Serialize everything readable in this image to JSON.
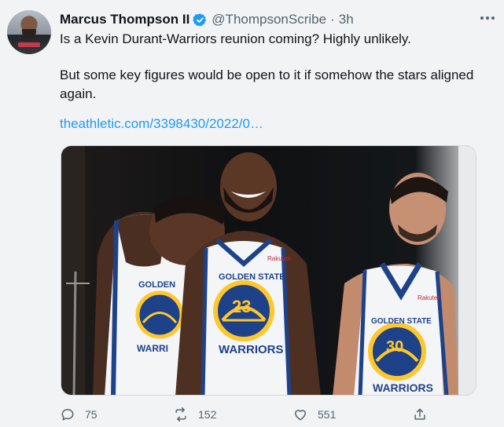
{
  "tweet": {
    "author_name": "Marcus Thompson II",
    "handle": "@ThompsonScribe",
    "separator": "·",
    "time": "3h",
    "text_line1": "Is a Kevin Durant-Warriors reunion coming? Highly unlikely.",
    "text_line2": "But some key figures would be open to it if somehow the stars aligned again.",
    "link": "theathletic.com/3398430/2022/0…"
  },
  "media": {
    "jersey_left_text": "GOLDEN STATE WARRIORS",
    "jersey_center_number": "23",
    "jersey_right_number": "30",
    "sponsor": "Rakuten"
  },
  "actions": {
    "reply_count": "75",
    "retweet_count": "152",
    "like_count": "551"
  },
  "colors": {
    "link": "#1d9bf0",
    "secondary_text": "#536471",
    "warriors_blue": "#1d428a",
    "warriors_gold": "#ffc72c"
  },
  "icons": [
    "verified-badge-icon",
    "more-options-icon",
    "reply-icon",
    "retweet-icon",
    "like-icon",
    "share-icon"
  ]
}
